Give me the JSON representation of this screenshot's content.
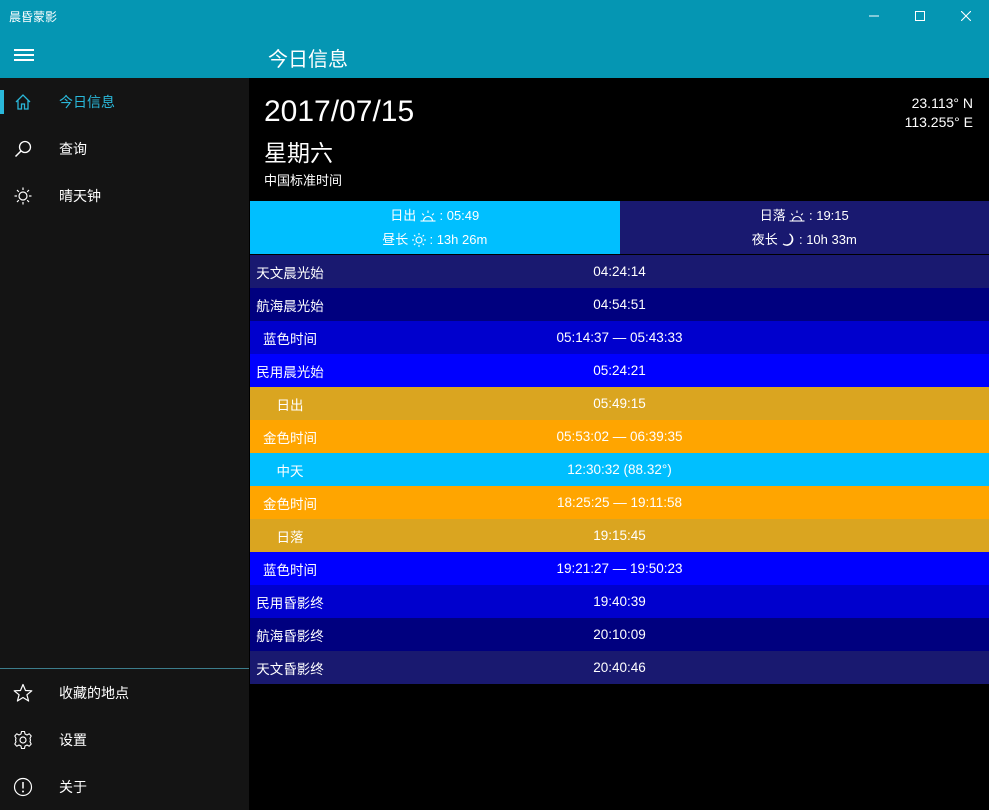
{
  "window": {
    "title": "晨昏蒙影",
    "minimize_icon": "minimize-icon",
    "maximize_icon": "maximize-icon",
    "close_icon": "close-icon"
  },
  "header": {
    "title": "今日信息"
  },
  "sidebar": {
    "items": [
      {
        "label": "今日信息",
        "icon": "home-icon",
        "active": true
      },
      {
        "label": "查询",
        "icon": "search-icon",
        "active": false
      },
      {
        "label": "晴天钟",
        "icon": "sun-icon",
        "active": false
      }
    ],
    "bottom_items": [
      {
        "label": "收藏的地点",
        "icon": "star-icon"
      },
      {
        "label": "设置",
        "icon": "gear-icon"
      },
      {
        "label": "关于",
        "icon": "info-icon"
      }
    ]
  },
  "today": {
    "date": "2017/07/15",
    "weekday": "星期六",
    "timezone": "中国标准时间",
    "latitude": "23.113° N",
    "longitude": "113.255° E"
  },
  "sun_summary": {
    "sunrise_label": "日出",
    "sunrise_time": "05:49",
    "day_length_label": "昼长",
    "day_length": "13h 26m",
    "sunset_label": "日落",
    "sunset_time": "19:15",
    "night_length_label": "夜长",
    "night_length": "10h 33m",
    "day_color": "#00bfff",
    "night_color": "#191970"
  },
  "times": [
    {
      "name": "天文晨光始",
      "value": "04:24:14",
      "color": "#191970"
    },
    {
      "name": "航海晨光始",
      "value": "04:54:51",
      "color": "#00007f"
    },
    {
      "name": "蓝色时间",
      "value": "05:14:37 — 05:43:33",
      "color": "#0000cd"
    },
    {
      "name": "民用晨光始",
      "value": "05:24:21",
      "color": "#0000ff"
    },
    {
      "name": "日出",
      "value": "05:49:15",
      "color": "#daa520"
    },
    {
      "name": "金色时间",
      "value": "05:53:02 — 06:39:35",
      "color": "#ffa500"
    },
    {
      "name": "中天",
      "value": "12:30:32 (88.32°)",
      "color": "#00bfff"
    },
    {
      "name": "金色时间",
      "value": "18:25:25 — 19:11:58",
      "color": "#ffa500"
    },
    {
      "name": "日落",
      "value": "19:15:45",
      "color": "#daa520"
    },
    {
      "name": "蓝色时间",
      "value": "19:21:27 — 19:50:23",
      "color": "#0000ff"
    },
    {
      "name": "民用昏影终",
      "value": "19:40:39",
      "color": "#0000cd"
    },
    {
      "name": "航海昏影终",
      "value": "20:10:09",
      "color": "#00007f"
    },
    {
      "name": "天文昏影终",
      "value": "20:40:46",
      "color": "#191970"
    }
  ]
}
